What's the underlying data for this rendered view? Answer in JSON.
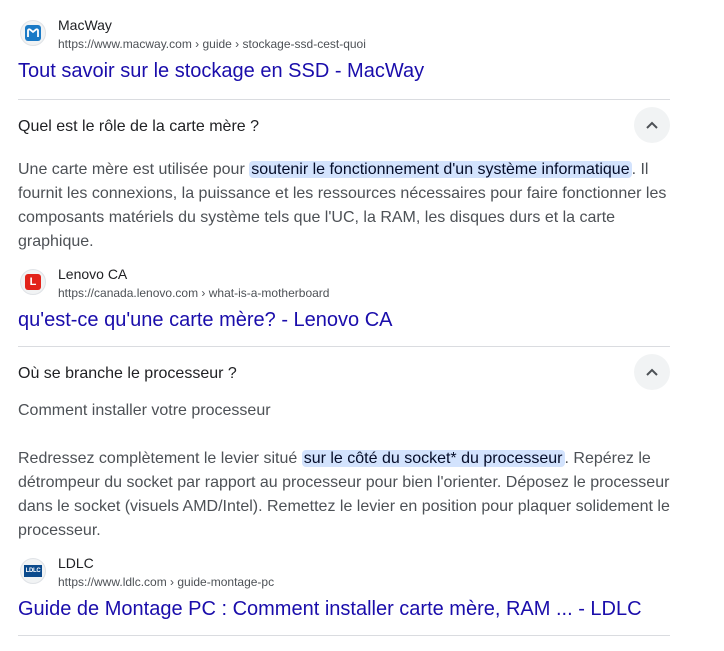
{
  "results": [
    {
      "source_name": "MacWay",
      "url": "https://www.macway.com › guide › stockage-ssd-cest-quoi",
      "favicon_icon": "macway-logo-icon",
      "favicon_color": "#1a7ac6",
      "favicon_letter": "m",
      "title": "Tout savoir sur le stockage en SSD - MacWay"
    },
    {
      "source_name": "Lenovo CA",
      "url": "https://canada.lenovo.com › what-is-a-motherboard",
      "favicon_icon": "lenovo-logo-icon",
      "favicon_color": "#e2231a",
      "favicon_letter": "L",
      "title": "qu'est-ce qu'une carte mère? - Lenovo CA"
    },
    {
      "source_name": "LDLC",
      "url": "https://www.ldlc.com › guide-montage-pc",
      "favicon_icon": "ldlc-logo-icon",
      "favicon_color": "#0b4a8c",
      "favicon_letter": "LDLC",
      "title": "Guide de Montage PC : Comment installer carte mère, RAM ... - LDLC"
    }
  ],
  "questions": [
    {
      "question": "Quel est le rôle de la carte mère ?",
      "expanded_icon": "chevron-up-icon",
      "answer_before": "Une carte mère est utilisée pour ",
      "answer_highlight": "soutenir le fonctionnement d'un système informatique",
      "answer_after": ". Il fournit les connexions, la puissance et les ressources nécessaires pour faire fonctionner les composants matériels du système tels que l'UC, la RAM, les disques durs et la carte graphique."
    },
    {
      "question": "Où se branche le processeur ?",
      "expanded_icon": "chevron-up-icon",
      "answer_intro": "Comment installer votre processeur",
      "answer_before": "Redressez complètement le levier situé ",
      "answer_highlight": "sur le côté du socket* du processeur",
      "answer_after": ". Repérez le détrompeur du socket par rapport au processeur pour bien l'orienter. Déposez le processeur dans le socket (visuels AMD/Intel). Remettez le levier en position pour plaquer solidement le processeur."
    }
  ],
  "colors": {
    "link": "#1a0dab",
    "highlight_bg": "#d3e3fd",
    "divider": "#dadce0"
  }
}
